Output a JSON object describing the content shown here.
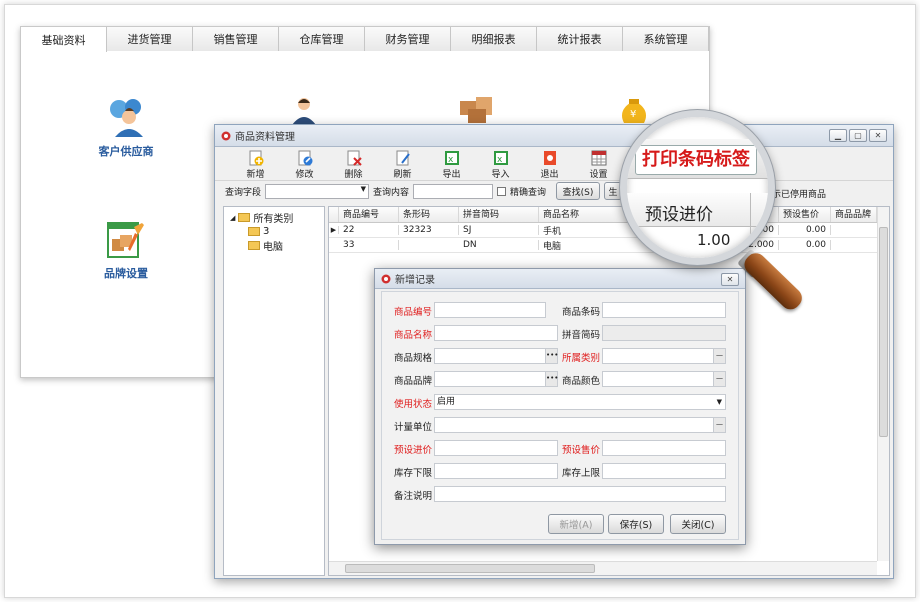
{
  "tabs": [
    "基础资料",
    "进货管理",
    "销售管理",
    "仓库管理",
    "财务管理",
    "明细报表",
    "统计报表",
    "系统管理"
  ],
  "modules": [
    {
      "label": "客户供应商",
      "icon": "customer-supplier-icon"
    },
    {
      "label": "",
      "icon": "employee-icon"
    },
    {
      "label": "",
      "icon": "goods-box-icon"
    },
    {
      "label": "",
      "icon": "money-bag-icon"
    },
    {
      "label": "品牌设置",
      "icon": "brand-settings-icon"
    }
  ],
  "product_window": {
    "title": "商品资料管理",
    "toolbar": [
      {
        "label": "新增",
        "icon": "add-icon"
      },
      {
        "label": "修改",
        "icon": "edit-icon"
      },
      {
        "label": "删除",
        "icon": "delete-icon"
      },
      {
        "label": "刷新",
        "icon": "refresh-icon"
      },
      {
        "label": "导出",
        "icon": "export-icon"
      },
      {
        "label": "导入",
        "icon": "import-icon"
      },
      {
        "label": "退出",
        "icon": "exit-icon"
      },
      {
        "label": "设置",
        "icon": "settings-icon"
      }
    ],
    "search": {
      "field_label": "查询字段",
      "content_label": "查询内容",
      "exact_label": "精确查询",
      "search_button": "查找(S)",
      "gen_button": "生",
      "show_disabled": "显示已停用商品"
    },
    "tree": {
      "root": "所有类别",
      "children": [
        "3",
        "电脑"
      ]
    },
    "columns": [
      "商品编号",
      "条形码",
      "拼音简码",
      "商品名称",
      "预设进价",
      "预设售价",
      "商品品牌"
    ],
    "rows": [
      {
        "id": "22",
        "barcode": "32323",
        "pinyin": "SJ",
        "name": "手机",
        "cost": "10.000",
        "price": "0.00"
      },
      {
        "id": "33",
        "barcode": "",
        "pinyin": "DN",
        "name": "电脑",
        "cost": "12.000",
        "price": "0.00"
      }
    ]
  },
  "dialog": {
    "title": "新增记录",
    "fields": {
      "code": "商品编号",
      "barcode": "商品条码",
      "name": "商品名称",
      "pinyin": "拼音简码",
      "spec": "商品规格",
      "category": "所属类别",
      "brand": "商品品牌",
      "color": "商品颜色",
      "status": "使用状态",
      "status_value": "启用",
      "unit": "计量单位",
      "cost": "预设进价",
      "price": "预设售价",
      "stock_min": "库存下限",
      "stock_max": "库存上限",
      "remark": "备注说明"
    },
    "buttons": {
      "add": "新增(A)",
      "save": "保存(S)",
      "close": "关闭(C)"
    }
  },
  "magnifier": {
    "headline": "打印条码标签",
    "column": "预设进价",
    "value": "1.00"
  },
  "colors": {
    "required": "#e02020",
    "accent": "#2a5c9e"
  }
}
